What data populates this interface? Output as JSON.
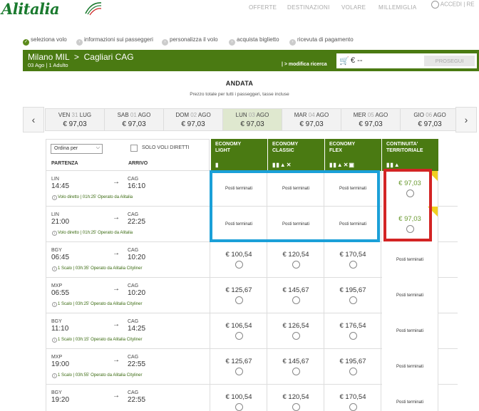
{
  "header": {
    "logo": "Alitalia",
    "nav": [
      "OFFERTE",
      "DESTINAZIONI",
      "VOLARE",
      "MILLEMIGLIA"
    ],
    "account": "ACCEDI | RE"
  },
  "steps": [
    {
      "num": "1",
      "label": "seleziona volo"
    },
    {
      "num": "2",
      "label": "informazioni sui passeggeri"
    },
    {
      "num": "3",
      "label": "personalizza il volo"
    },
    {
      "num": "4",
      "label": "acquista biglietto"
    },
    {
      "num": "5",
      "label": "ricevuta di pagamento"
    }
  ],
  "route": {
    "from": "Milano MIL",
    "sep": ">",
    "to": "Cagliari CAG",
    "meta": "03 Ago | 1 Adulto",
    "modify": "| > modifica ricerca"
  },
  "cart": {
    "price": "€ --",
    "button": "PROSEGUI"
  },
  "title": "ANDATA",
  "subtitle": "Prezzo totale per tutti i passeggeri, tasse incluse",
  "dates": [
    {
      "day": "VEN",
      "num": "31",
      "month": "LUG",
      "price": "€ 97,03"
    },
    {
      "day": "SAB",
      "num": "01",
      "month": "AGO",
      "price": "€ 97,03"
    },
    {
      "day": "DOM",
      "num": "02",
      "month": "AGO",
      "price": "€ 97,03"
    },
    {
      "day": "LUN",
      "num": "03",
      "month": "AGO",
      "price": "€ 97,03"
    },
    {
      "day": "MAR",
      "num": "04",
      "month": "AGO",
      "price": "€ 97,03"
    },
    {
      "day": "MER",
      "num": "05",
      "month": "AGO",
      "price": "€ 97,03"
    },
    {
      "day": "GIO",
      "num": "06",
      "month": "AGO",
      "price": "€ 97,03"
    }
  ],
  "table": {
    "sort_label": "Ordina per",
    "direct_only": "SOLO VOLI DIRETTI",
    "col_departure": "PARTENZA",
    "col_arrival": "ARRIVO",
    "fares": [
      {
        "line1": "ECONOMY",
        "line2": "LIGHT",
        "icons": "🧳"
      },
      {
        "line1": "ECONOMY",
        "line2": "CLASSIC",
        "icons": "🧳🧳💺✕"
      },
      {
        "line1": "ECONOMY",
        "line2": "FLEX",
        "icons": "🧳🧳💺✕↺"
      },
      {
        "line1": "CONTINUITA'",
        "line2": "TERRITORIALE",
        "icons": "🧳🧳💺"
      }
    ],
    "sold_out": "Posti terminati",
    "rows": [
      {
        "from": "LIN",
        "dep": "14:45",
        "to": "CAG",
        "arr": "16:10",
        "detail": "Volo diretto | 01h:25' Operato da Alitalia",
        "light": "",
        "classic": "",
        "flex": "",
        "cont": "€ 97,03"
      },
      {
        "from": "LIN",
        "dep": "21:00",
        "to": "CAG",
        "arr": "22:25",
        "detail": "Volo diretto | 01h:25' Operato da Alitalia",
        "light": "",
        "classic": "",
        "flex": "",
        "cont": "€ 97,03"
      },
      {
        "from": "BGY",
        "dep": "06:45",
        "to": "CAG",
        "arr": "10:20",
        "detail": "1 Scalo | 03h:35' Operato da Alitalia Cityliner",
        "light": "€ 100,54",
        "classic": "€ 120,54",
        "flex": "€ 170,54",
        "cont": ""
      },
      {
        "from": "MXP",
        "dep": "06:55",
        "to": "CAG",
        "arr": "10:20",
        "detail": "1 Scalo | 03h:25' Operato da Alitalia Cityliner",
        "light": "€ 125,67",
        "classic": "€ 145,67",
        "flex": "€ 195,67",
        "cont": ""
      },
      {
        "from": "BGY",
        "dep": "11:10",
        "to": "CAG",
        "arr": "14:25",
        "detail": "1 Scalo | 03h:15' Operato da Alitalia Cityliner",
        "light": "€ 106,54",
        "classic": "€ 126,54",
        "flex": "€ 176,54",
        "cont": ""
      },
      {
        "from": "MXP",
        "dep": "19:00",
        "to": "CAG",
        "arr": "22:55",
        "detail": "1 Scalo | 03h:55' Operato da Alitalia Cityliner",
        "light": "€ 125,67",
        "classic": "€ 145,67",
        "flex": "€ 195,67",
        "cont": ""
      },
      {
        "from": "BGY",
        "dep": "19:20",
        "to": "CAG",
        "arr": "22:55",
        "detail": "",
        "light": "€ 100,54",
        "classic": "€ 120,54",
        "flex": "€ 170,54",
        "cont": ""
      }
    ]
  },
  "colors": {
    "green": "#4a7a12",
    "highlight_blue": "#1ba0d8",
    "highlight_red": "#d32424",
    "ribbon": "#f0d020"
  }
}
